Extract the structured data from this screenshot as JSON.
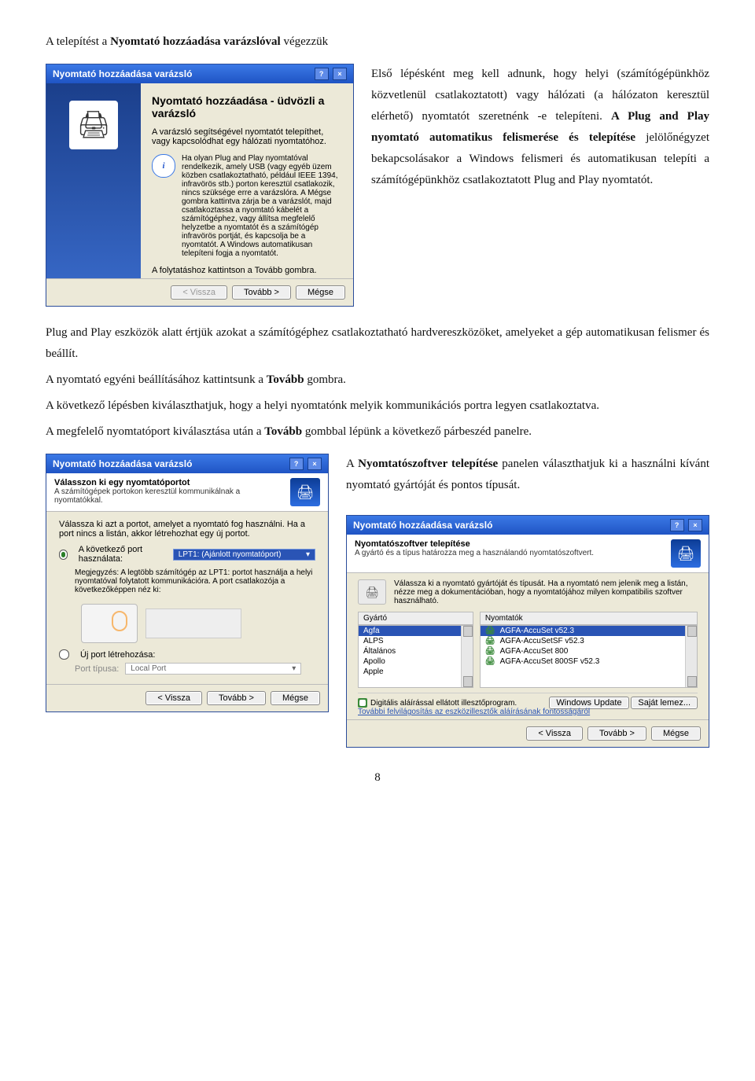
{
  "doc": {
    "lead_prefix": "A telepítést a ",
    "lead_bold": "Nyomtató hozzáadása varázslóval",
    "lead_suffix": " végezzük",
    "para1a_prefix": "Első lépésként meg kell adnunk, hogy helyi (számítógépünkhöz közvetlenül csatlakoztatott) vagy hálózati (a hálózaton keresztül elérhető) nyomtatót szeretnénk -e telepíteni. ",
    "para1a_bold1": "A Plug and Play nyomtató automatikus felismerése és telepítése",
    "para1a_mid": " jelölőnégyzet bekapcsolásakor a Windows felismeri és automatikusan telepíti a számítógépünkhöz csatlakoztatott Plug and Play nyomtatót.",
    "para2": "Plug and Play eszközök alatt értjük azokat a számítógéphez csatlakoztatható hardvereszközöket, amelyeket a gép automatikusan felismer és beállít.",
    "para3_prefix": "A nyomtató egyéni beállításához kattintsunk a ",
    "para3_bold": "Tovább",
    "para3_suffix": " gombra.",
    "para4": "A következő lépésben kiválaszthatjuk, hogy a helyi nyomtatónk melyik kommunikációs portra legyen csatlakoztatva.",
    "para5_prefix": "A megfelelő nyomtatóport kiválasztása után a ",
    "para5_bold": "Tovább",
    "para5_suffix": " gombbal lépünk a következő párbeszéd panelre.",
    "para6_prefix": "A ",
    "para6_bold": "Nyomtatószoftver telepítése",
    "para6_suffix": " panelen választhatjuk ki a használni kívánt nyomtató gyártóját és pontos típusát.",
    "page_num": "8"
  },
  "wiz_common": {
    "title": "Nyomtató hozzáadása varázsló",
    "back": "< Vissza",
    "next": "Tovább >",
    "cancel": "Mégse"
  },
  "wiz1": {
    "heading": "Nyomtató hozzáadása - üdvözli a varázsló",
    "l1": "A varázsló segítségével nyomtatót telepíthet, vagy kapcsolódhat egy hálózati nyomtatóhoz.",
    "info": "Ha olyan Plug and Play nyomtatóval rendelkezik, amely USB (vagy egyéb üzem közben csatlakoztatható, például IEEE 1394, infravörös stb.) porton keresztül csatlakozik, nincs szüksége erre a varázslóra. A Mégse gombra kattintva zárja be a varázslót, majd csatlakoztassa a nyomtató kábelét a számítógéphez, vagy állítsa megfelelő helyzetbe a nyomtatót és a számítógép infravörös portját, és kapcsolja be a nyomtatót. A Windows automatikusan telepíteni fogja a nyomtatót.",
    "cont": "A folytatáshoz kattintson a Tovább gombra."
  },
  "wiz2": {
    "hh": "Válasszon ki egy nyomtatóportot",
    "hs": "A számítógépek portokon keresztül kommunikálnak a nyomtatókkal.",
    "lead": "Válassza ki azt a portot, amelyet a nyomtató fog használni. Ha a port nincs a listán, akkor létrehozhat egy új portot.",
    "r1": "A következő port használata:",
    "dd": "LPT1: (Ajánlott nyomtatóport)",
    "note": "Megjegyzés: A legtöbb számítógép az LPT1: portot használja a helyi nyomtatóval folytatott kommunikációra. A port csatlakozója a következőképpen néz ki:",
    "r2": "Új port létrehozása:",
    "pt_lbl": "Port típusa:",
    "pt_val": "Local Port"
  },
  "wiz3": {
    "hh": "Nyomtatószoftver telepítése",
    "hs": "A gyártó és a típus határozza meg a használandó nyomtatószoftvert.",
    "lead": "Válassza ki a nyomtató gyártóját és típusát. Ha a nyomtató nem jelenik meg a listán, nézze meg a dokumentációban, hogy a nyomtatójához milyen kompatibilis szoftver használható.",
    "col1": "Gyártó",
    "col2": "Nyomtatók",
    "mfrs": [
      "Agfa",
      "ALPS",
      "Általános",
      "Apollo",
      "Apple"
    ],
    "models": [
      "AGFA-AccuSet v52.3",
      "AGFA-AccuSetSF v52.3",
      "AGFA-AccuSet 800",
      "AGFA-AccuSet 800SF v52.3"
    ],
    "signed": "Digitális aláírással ellátott illesztőprogram.",
    "more": "További felvilágosítás az eszközillesztők aláírásának fontosságáról",
    "wu": "Windows Update",
    "disk": "Saját lemez..."
  }
}
